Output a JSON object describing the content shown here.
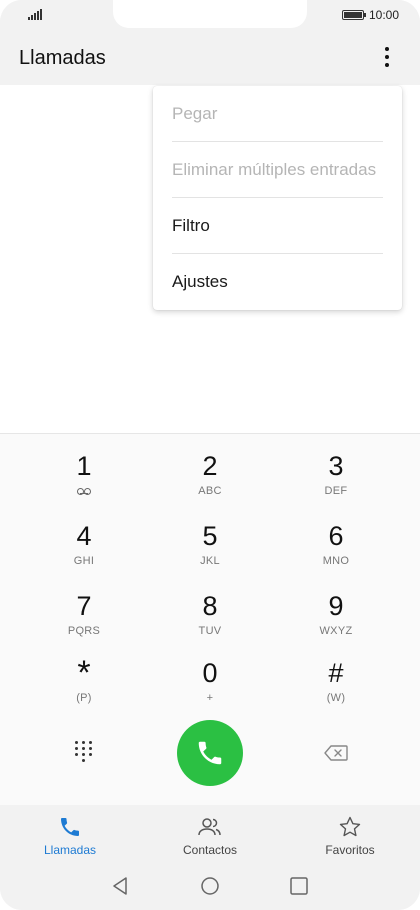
{
  "status_bar": {
    "time": "10:00",
    "battery_level": 1.0
  },
  "app_bar": {
    "title": "Llamadas",
    "more_icon": "more-vertical-icon"
  },
  "menu": {
    "items": [
      {
        "label": "Pegar",
        "enabled": false
      },
      {
        "label": "Eliminar múltiples entradas",
        "enabled": false
      },
      {
        "label": "Filtro",
        "enabled": true
      },
      {
        "label": "Ajustes",
        "enabled": true
      }
    ]
  },
  "dialpad": {
    "keys": [
      {
        "digit": "1",
        "sub": "",
        "icon": "voicemail-icon"
      },
      {
        "digit": "2",
        "sub": "ABC"
      },
      {
        "digit": "3",
        "sub": "DEF"
      },
      {
        "digit": "4",
        "sub": "GHI"
      },
      {
        "digit": "5",
        "sub": "JKL"
      },
      {
        "digit": "6",
        "sub": "MNO"
      },
      {
        "digit": "7",
        "sub": "PQRS"
      },
      {
        "digit": "8",
        "sub": "TUV"
      },
      {
        "digit": "9",
        "sub": "WXYZ"
      },
      {
        "digit": "*",
        "sub": "(P)"
      },
      {
        "digit": "0",
        "sub": "+"
      },
      {
        "digit": "#",
        "sub": "(W)"
      }
    ],
    "call_button_color": "#2bc043"
  },
  "bottom_nav": {
    "items": [
      {
        "label": "Llamadas",
        "icon": "phone-icon",
        "active": true
      },
      {
        "label": "Contactos",
        "icon": "contacts-icon",
        "active": false
      },
      {
        "label": "Favoritos",
        "icon": "star-icon",
        "active": false
      }
    ],
    "active_color": "#1e7bd3"
  }
}
